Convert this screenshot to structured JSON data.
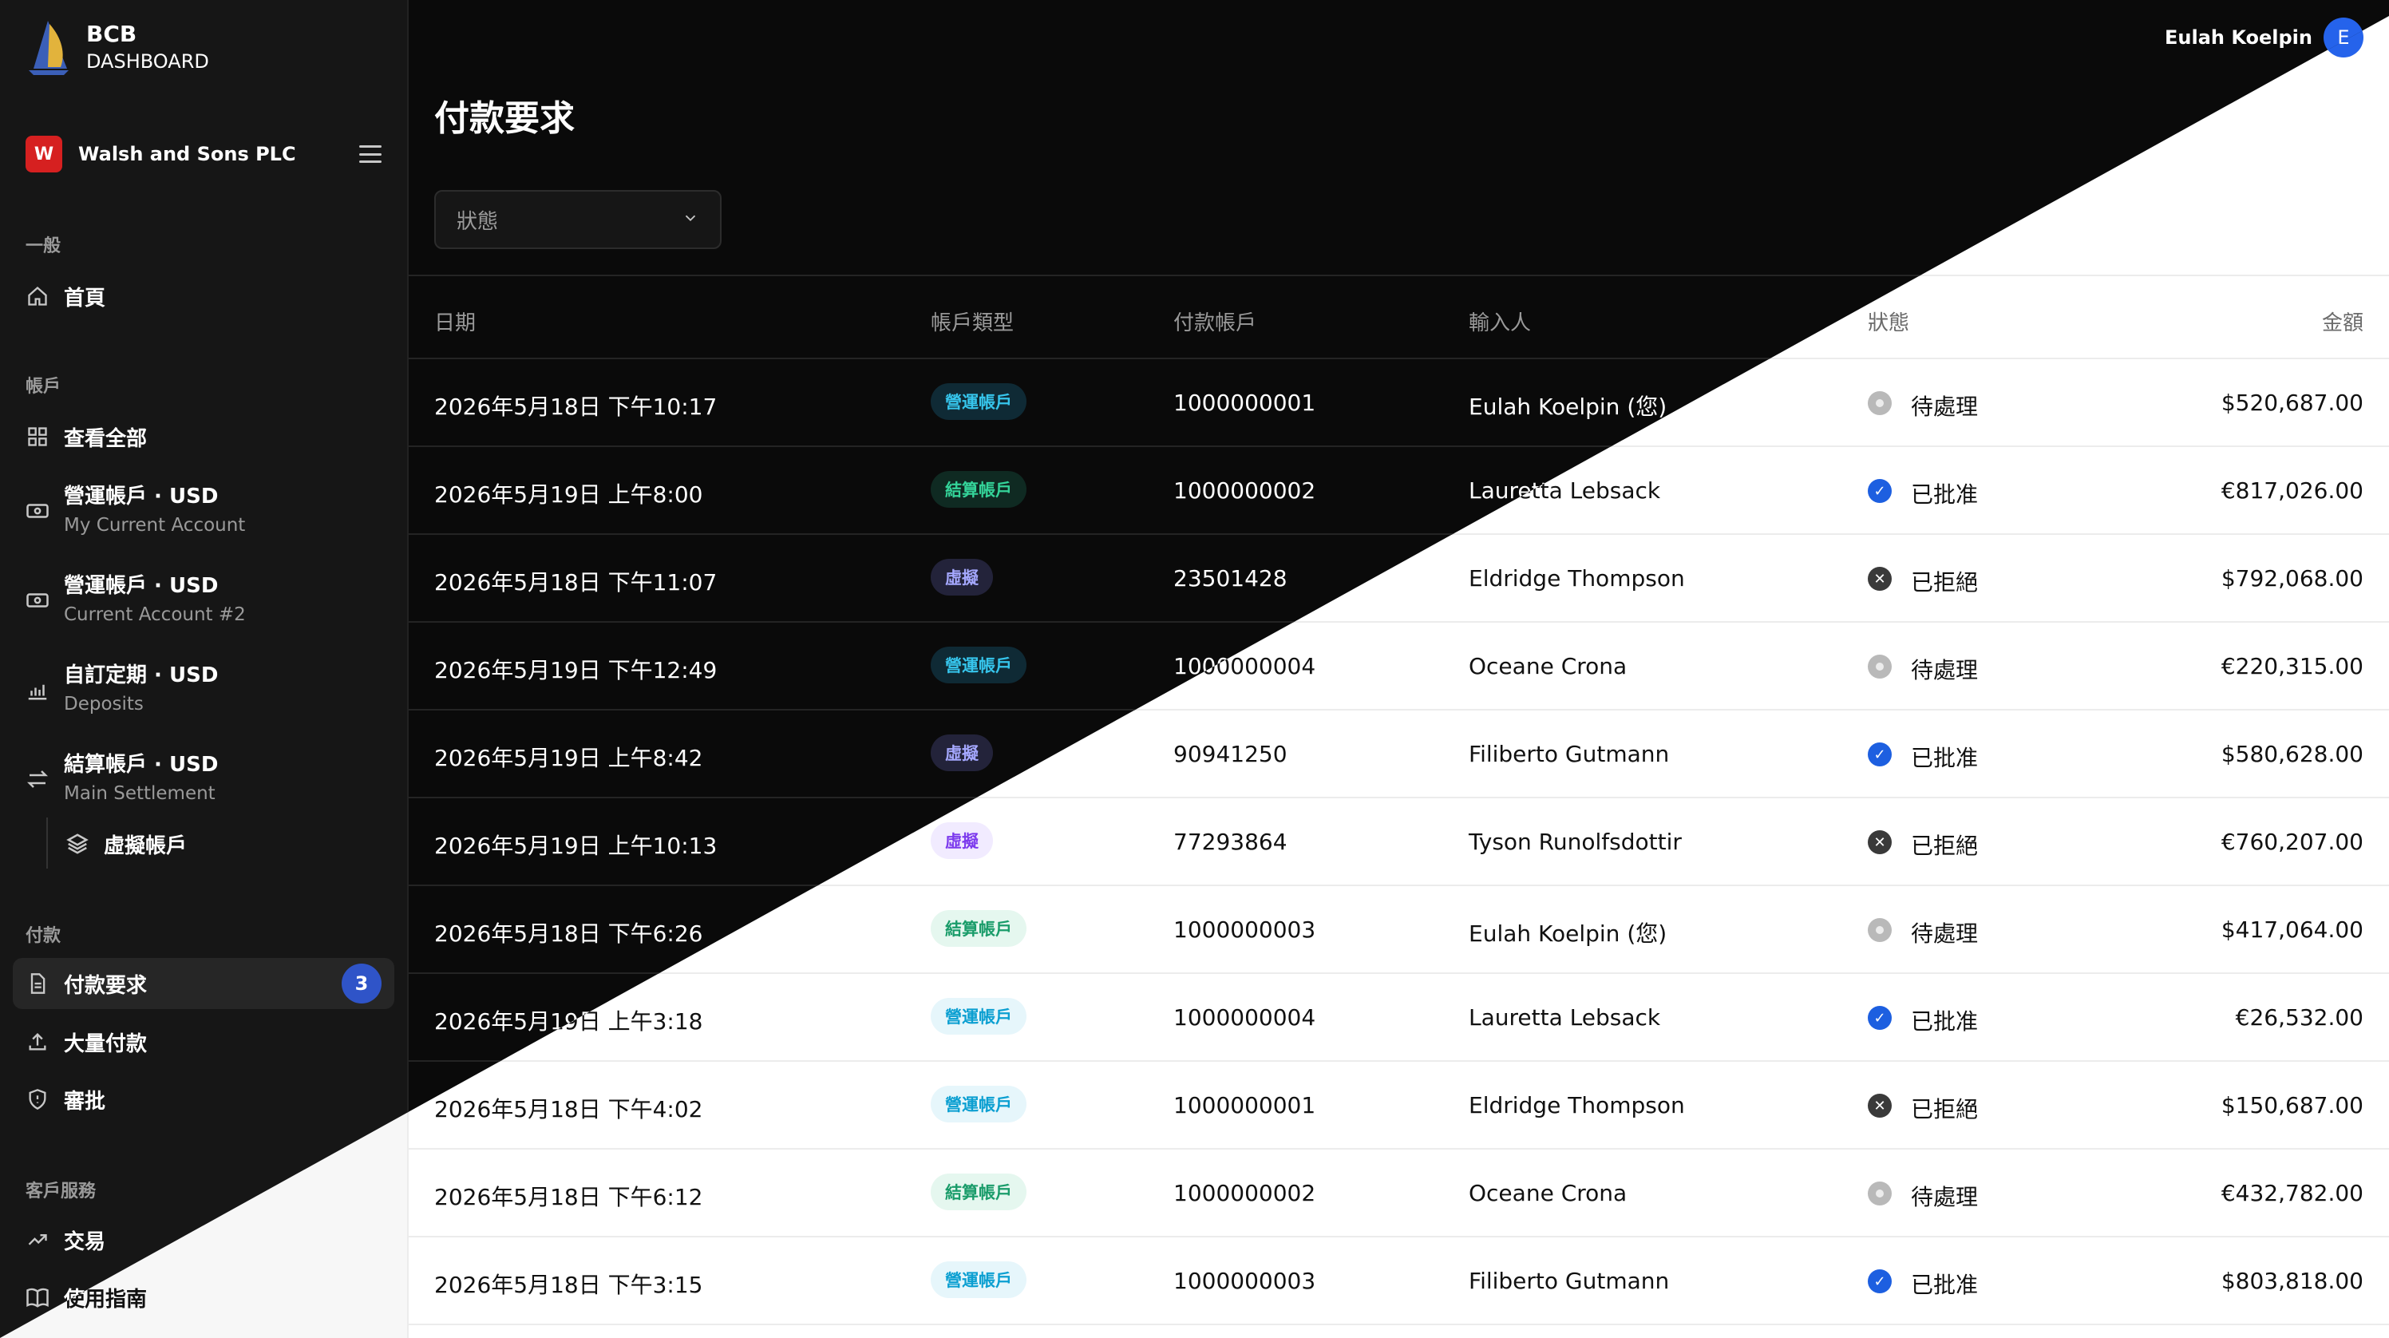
{
  "brand": {
    "line1": "BCB",
    "line2": "DASHBOARD"
  },
  "company": {
    "initial": "W",
    "name": "Walsh and Sons PLC"
  },
  "user": {
    "name": "Eulah Koelpin",
    "initial": "E"
  },
  "sidebar": {
    "section_general": "一般",
    "home": "首頁",
    "section_accounts": "帳戶",
    "view_all": "查看全部",
    "accounts": [
      {
        "label": "營運帳戶 · USD",
        "sub": "My Current Account",
        "icon": "cash-icon"
      },
      {
        "label": "營運帳戶 · USD",
        "sub": "Current Account #2",
        "icon": "cash-icon"
      },
      {
        "label": "自訂定期 · USD",
        "sub": "Deposits",
        "icon": "chart-bars-icon"
      },
      {
        "label": "結算帳戶 · USD",
        "sub": "Main Settlement",
        "icon": "transfer-arrows-icon"
      }
    ],
    "virtual_accounts": "虛擬帳戶",
    "section_payments": "付款",
    "payment_requests": "付款要求",
    "payment_requests_count": "3",
    "bulk_payments": "大量付款",
    "approvals": "審批",
    "section_service": "客戶服務",
    "transactions": "交易",
    "guide": "使用指南"
  },
  "main": {
    "title": "付款要求",
    "status_filter": "狀態",
    "columns": {
      "date": "日期",
      "account_type": "帳戶類型",
      "account": "付款帳戶",
      "inputter": "輸入人",
      "status": "狀態",
      "amount": "金額"
    }
  },
  "rows": [
    {
      "date": "2026年5月18日 下午10:17",
      "type": "營運帳戶",
      "type_key": "op",
      "account": "1000000001",
      "inputter": "Eulah Koelpin (您)",
      "status": "待處理",
      "status_key": "pending",
      "amount": "$520,687.00"
    },
    {
      "date": "2026年5月19日 上午8:00",
      "type": "結算帳戶",
      "type_key": "st",
      "account": "1000000002",
      "inputter": "Lauretta Lebsack",
      "status": "已批准",
      "status_key": "approved",
      "amount": "€817,026.00"
    },
    {
      "date": "2026年5月18日 下午11:07",
      "type": "虛擬",
      "type_key": "vr",
      "account": "23501428",
      "inputter": "Eldridge Thompson",
      "status": "已拒絕",
      "status_key": "rejected",
      "amount": "$792,068.00"
    },
    {
      "date": "2026年5月19日 下午12:49",
      "type": "營運帳戶",
      "type_key": "op",
      "account": "1000000004",
      "inputter": "Oceane Crona",
      "status": "待處理",
      "status_key": "pending",
      "amount": "€220,315.00"
    },
    {
      "date": "2026年5月19日 上午8:42",
      "type": "虛擬",
      "type_key": "vr",
      "account": "90941250",
      "inputter": "Filiberto Gutmann",
      "status": "已批准",
      "status_key": "approved",
      "amount": "$580,628.00"
    },
    {
      "date": "2026年5月19日 上午10:13",
      "type": "虛擬",
      "type_key": "vr",
      "account": "77293864",
      "inputter": "Tyson Runolfsdottir",
      "status": "已拒絕",
      "status_key": "rejected",
      "amount": "€760,207.00"
    },
    {
      "date": "2026年5月18日 下午6:26",
      "type": "結算帳戶",
      "type_key": "st",
      "account": "1000000003",
      "inputter": "Eulah Koelpin (您)",
      "status": "待處理",
      "status_key": "pending",
      "amount": "$417,064.00"
    },
    {
      "date": "2026年5月19日 上午3:18",
      "type": "營運帳戶",
      "type_key": "op",
      "account": "1000000004",
      "inputter": "Lauretta Lebsack",
      "status": "已批准",
      "status_key": "approved",
      "amount": "€26,532.00"
    },
    {
      "date": "2026年5月18日 下午4:02",
      "type": "營運帳戶",
      "type_key": "op",
      "account": "1000000001",
      "inputter": "Eldridge Thompson",
      "status": "已拒絕",
      "status_key": "rejected",
      "amount": "$150,687.00"
    },
    {
      "date": "2026年5月18日 下午6:12",
      "type": "結算帳戶",
      "type_key": "st",
      "account": "1000000002",
      "inputter": "Oceane Crona",
      "status": "待處理",
      "status_key": "pending",
      "amount": "€432,782.00"
    },
    {
      "date": "2026年5月18日 下午3:15",
      "type": "營運帳戶",
      "type_key": "op",
      "account": "1000000003",
      "inputter": "Filiberto Gutmann",
      "status": "已批准",
      "status_key": "approved",
      "amount": "$803,818.00"
    }
  ],
  "colors": {
    "company_badge": "#d62020",
    "avatar": "#2563eb",
    "count_badge": "#2f54c8",
    "approved": "#1d5fe0"
  }
}
